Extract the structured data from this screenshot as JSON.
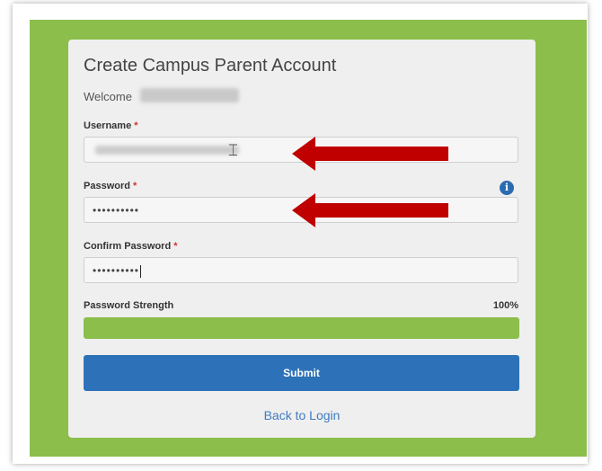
{
  "form": {
    "title": "Create Campus Parent Account",
    "welcome_label": "Welcome",
    "username_label": "Username",
    "password_label": "Password",
    "password_value": "••••••••••",
    "confirm_label": "Confirm Password",
    "confirm_value": "••••••••••",
    "required_mark": "*",
    "strength_label": "Password Strength",
    "strength_text": "100%",
    "strength_fraction": 1.0,
    "submit_label": "Submit",
    "back_link": "Back to Login"
  },
  "icons": {
    "info": "info-icon",
    "arrow": "red-arrow-icon",
    "cursor": "text-cursor-icon"
  },
  "colors": {
    "background": "#8bbe4b",
    "primary": "#2d72b8",
    "arrow": "#c00000",
    "strength": "#8bbe4b"
  }
}
